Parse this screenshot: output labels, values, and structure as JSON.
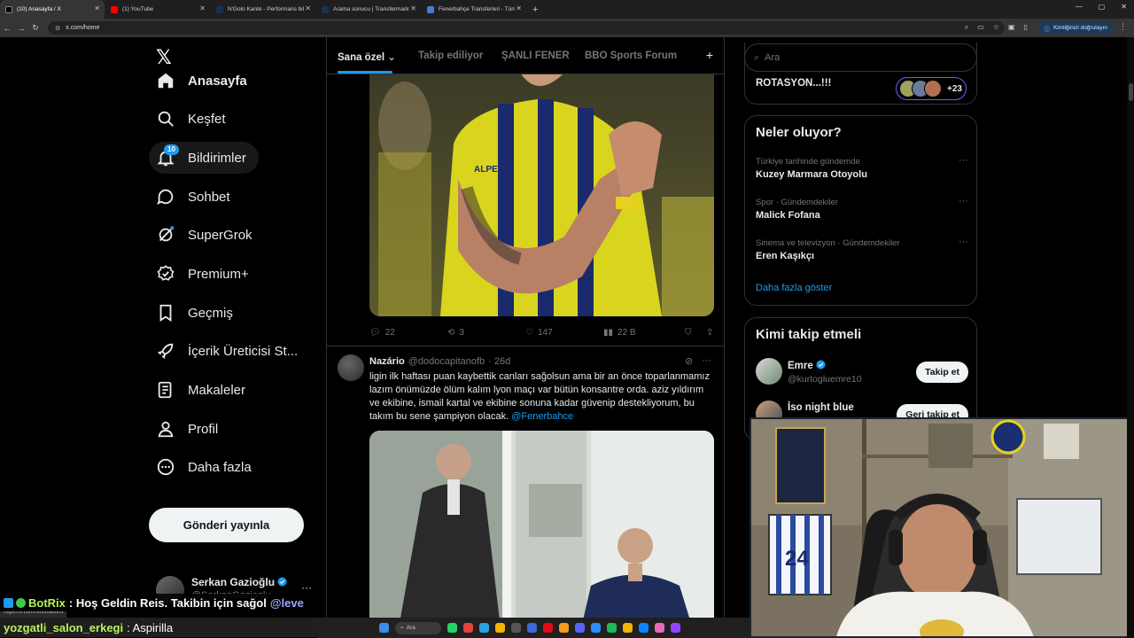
{
  "browser": {
    "tabs": [
      {
        "label": "(10) Anasayfa / X",
        "fav": "#000000",
        "active": true
      },
      {
        "label": "(1) YouTube",
        "fav": "#ff0000",
        "active": false
      },
      {
        "label": "N'Golo Kanté - Performans bilg",
        "fav": "#1a3151",
        "active": false
      },
      {
        "label": "Arama sonucu | Transfermarkt",
        "fav": "#1a3151",
        "active": false
      },
      {
        "label": "Fenerbahçe Transferleri - Tüm T",
        "fav": "#4a7bd4",
        "active": false
      }
    ],
    "url": "x.com/home",
    "verify_label": "Kimliğinizi doğrulayın",
    "status_url": "https://x.com/notifications"
  },
  "nav": {
    "items": [
      {
        "label": "Anasayfa",
        "icon": "home-icon"
      },
      {
        "label": "Keşfet",
        "icon": "search-icon"
      },
      {
        "label": "Bildirimler",
        "icon": "bell-icon",
        "badge": "10"
      },
      {
        "label": "Sohbet",
        "icon": "chat-icon"
      },
      {
        "label": "SuperGrok",
        "icon": "grok-icon"
      },
      {
        "label": "Premium+",
        "icon": "premium-icon"
      },
      {
        "label": "Geçmiş",
        "icon": "bookmark-icon"
      },
      {
        "label": "İçerik Üreticisi St...",
        "icon": "rocket-icon"
      },
      {
        "label": "Makaleler",
        "icon": "article-icon"
      },
      {
        "label": "Profil",
        "icon": "person-icon"
      },
      {
        "label": "Daha fazla",
        "icon": "more-circle-icon"
      }
    ],
    "post_label": "Gönderi yayınla",
    "profile": {
      "name": "Serkan Gazioğlu",
      "handle": "@SerkanGazioglu"
    }
  },
  "timeline": {
    "tabs": [
      "Sana özel",
      "Takip ediliyor",
      "ŞANLI FENER",
      "BBO Sports Forum"
    ],
    "tweet1_actions": {
      "replies": "22",
      "retweets": "3",
      "likes": "147",
      "views": "22 B"
    },
    "tweet2": {
      "name": "Nazário",
      "handle": "@dodocapitanofb",
      "time": "· 26d",
      "text": "ligin ilk haftası puan kaybettik canları sağolsun ama bir an önce toparlanmamız lazım önümüzde ölüm kalım lyon maçı var bütün konsantre orda. aziz yıldırım ve ekibine, ismail kartal ve ekibine sonuna kadar güvenip destekliyorum, bu takım bu sene şampiyon olacak.",
      "mention": "@Fenerbahce"
    }
  },
  "sidebar": {
    "search_placeholder": "Ara",
    "rotation_text": "ROTASYON...!!!",
    "rotation_count": "+23",
    "trends_title": "Neler oluyor?",
    "trends": [
      {
        "context": "Türkiye tarihinde gündemde",
        "name": "Kuzey Marmara Otoyolu"
      },
      {
        "context": "Spor · Gündemdekiler",
        "name": "Malick Fofana"
      },
      {
        "context": "Sinema ve televizyon · Gündemdekiler",
        "name": "Eren Kaşıkçı"
      }
    ],
    "show_more": "Daha fazla göster",
    "who_title": "Kimi takip etmeli",
    "who": [
      {
        "name": "Emre",
        "handle": "@kurtogluemre10",
        "button": "Takip et"
      },
      {
        "name": "İso night blue",
        "handle": "",
        "button": "Geri takip et"
      }
    ]
  },
  "stream_chat": [
    {
      "user": "BotRix",
      "message": ": Hoş Geldin Reis. Takibin için sağol",
      "mention": "@leve"
    },
    {
      "user": "yozgatli_salon_erkegi",
      "message": ": Aspirilla"
    }
  ],
  "taskbar": {
    "search_label": "Ara"
  },
  "colors": {
    "accent": "#1d9bf0",
    "background": "#000000",
    "border": "#2f3336",
    "muted": "#71767b"
  }
}
